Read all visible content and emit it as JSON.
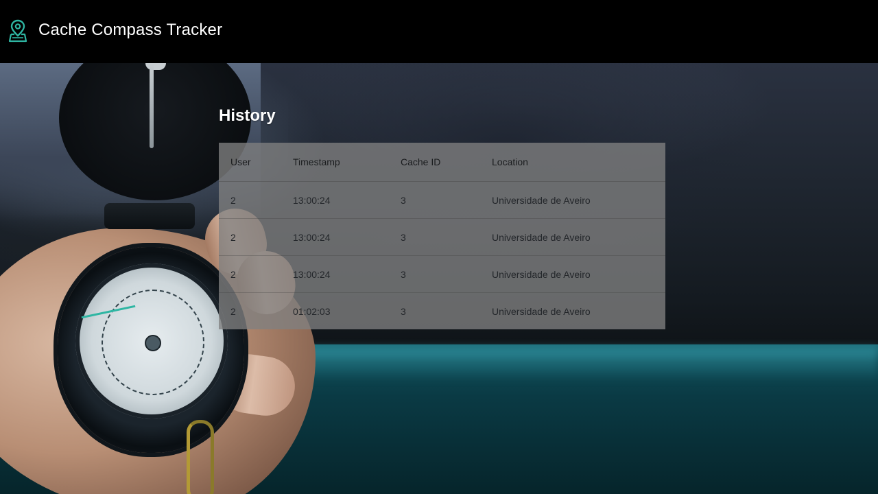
{
  "app": {
    "title": "Cache Compass Tracker",
    "logo_icon": "map-pin-icon",
    "accent_color": "#2fb6a3"
  },
  "page": {
    "heading": "History"
  },
  "history_table": {
    "columns": [
      "User",
      "Timestamp",
      "Cache ID",
      "Location"
    ],
    "rows": [
      [
        "2",
        "13:00:24",
        "3",
        "Universidade de Aveiro"
      ],
      [
        "2",
        "13:00:24",
        "3",
        "Universidade de Aveiro"
      ],
      [
        "2",
        "13:00:24",
        "3",
        "Universidade de Aveiro"
      ],
      [
        "2",
        "01:02:03",
        "3",
        "Universidade de Aveiro"
      ]
    ]
  }
}
